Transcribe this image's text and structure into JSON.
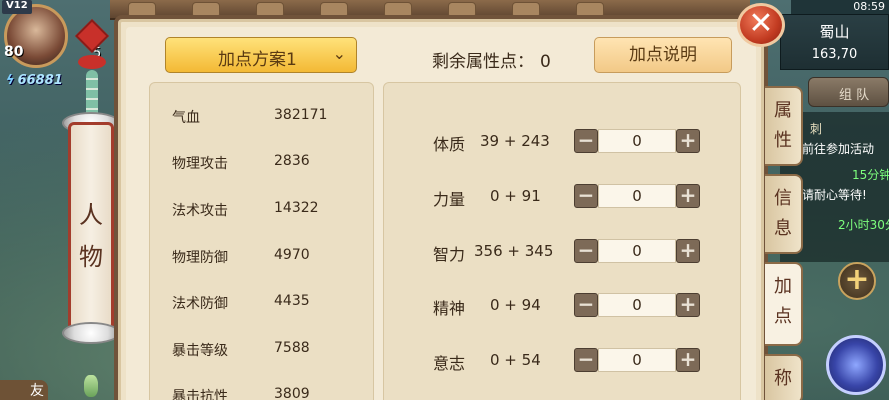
{
  "hud": {
    "vip": "V12",
    "level": "80",
    "level_badge": "5",
    "power": "66881",
    "clock": "08:59",
    "location_name": "蜀山",
    "location_coords": "163,70",
    "team_button": "组 队",
    "friend_label": "友"
  },
  "quest_tracker": {
    "lines": [
      {
        "text": "刺",
        "color": "#e8e0c0"
      },
      {
        "text": "前往参加活动",
        "color": "#ffffff"
      },
      {
        "text": "15分钟",
        "color": "#7dff7d"
      },
      {
        "text": "请耐心等待!",
        "color": "#ffffff"
      },
      {
        "text": "2小时30分",
        "color": "#7dff7d"
      }
    ]
  },
  "left_tab": {
    "label_line1": "人",
    "label_line2": "物"
  },
  "panel": {
    "plan_dropdown": "加点方案1",
    "remaining_label": "剩余属性点：",
    "remaining_value": "0",
    "help_button": "加点说明",
    "close_icon": "close-icon"
  },
  "stats": [
    {
      "label": "气血",
      "value": "382171"
    },
    {
      "label": "物理攻击",
      "value": "2836"
    },
    {
      "label": "法术攻击",
      "value": "14322"
    },
    {
      "label": "物理防御",
      "value": "4970"
    },
    {
      "label": "法术防御",
      "value": "4435"
    },
    {
      "label": "暴击等级",
      "value": "7588"
    },
    {
      "label": "暴击抗性",
      "value": "3809"
    }
  ],
  "attributes": [
    {
      "label": "体质",
      "base": "39 + 243",
      "points": "0"
    },
    {
      "label": "力量",
      "base": "0 + 91",
      "points": "0"
    },
    {
      "label": "智力",
      "base": "356 + 345",
      "points": "0"
    },
    {
      "label": "精神",
      "base": "0 + 94",
      "points": "0"
    },
    {
      "label": "意志",
      "base": "0 + 54",
      "points": "0"
    }
  ],
  "side_tabs": [
    {
      "line1": "属",
      "line2": "性"
    },
    {
      "line1": "信",
      "line2": "息"
    },
    {
      "line1": "加",
      "line2": "点"
    },
    {
      "line1": "称",
      "line2": ""
    }
  ],
  "colors": {
    "accent": "#f3b935",
    "frame": "#70533a",
    "close": "#c23b21"
  }
}
